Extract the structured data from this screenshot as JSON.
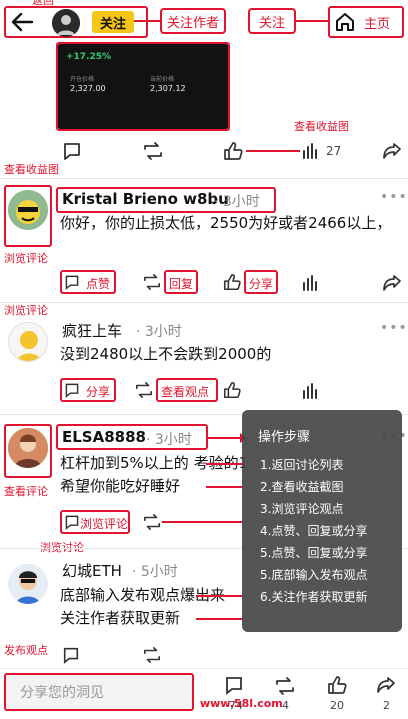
{
  "annotations": {
    "top_clip": "返回",
    "follow_author": "关注作者",
    "follow": "关注",
    "home": "主页",
    "view_chart_right": "查看收益图",
    "view_chart_left": "查看收益图",
    "browse_comments_1": "浏览评论",
    "browse_comments_2": "浏览评论",
    "view_chart_3": "查看评论",
    "browse_discussion": "浏览讨论",
    "post_opinion": "发布观点",
    "like": "点赞",
    "reply": "回复",
    "share": "分享",
    "share2": "分享",
    "view_opinion": "查看观点",
    "browse_comment_btn": "浏览评论"
  },
  "header": {
    "follow_button": "关注",
    "home_label": "主页"
  },
  "screenshot_card": {
    "percent": "+17.25%",
    "label1": "开仓价格",
    "label2": "当前价格",
    "value1": "2,327.00",
    "value2": "2,307.12"
  },
  "first_post": {
    "like_count": "27"
  },
  "comments": [
    {
      "username": "Kristal Brieno w8bu",
      "time": "· 3小时",
      "text": "你好，你的止损太低，2550为好或者2466以上，"
    },
    {
      "username": "疯狂上车",
      "time": "· 3小时",
      "text": "没到2480以上不会跌到2000的"
    },
    {
      "username": "ELSA8888",
      "time": "· 3小时",
      "text_line1": "杠杆加到5%以上的 考验的1",
      "text_line2": "希望你能吃好睡好"
    },
    {
      "username": "幻城ETH",
      "time": "· 5小时",
      "text_line1": "底部输入发布观点爆出来",
      "text_line2": "关注作者获取更新"
    }
  ],
  "steps": {
    "title": "操作步骤",
    "items": [
      "1.返回讨论列表",
      "2.查看收益截图",
      "3.浏览评论观点",
      "4.点赞、回复或分享",
      "5.点赞、回复或分享",
      "5.底部输入发布观点",
      "6.关注作者获取更新"
    ]
  },
  "bottom": {
    "placeholder": "分享您的洞见",
    "comment_count": "74",
    "repost_count": "4",
    "like_count": "20",
    "share_count": "2",
    "watermark": "www.58l.com"
  },
  "colors": {
    "accent": "#e0142e",
    "follow_yellow": "#f5c518",
    "overlay": "#464646"
  }
}
